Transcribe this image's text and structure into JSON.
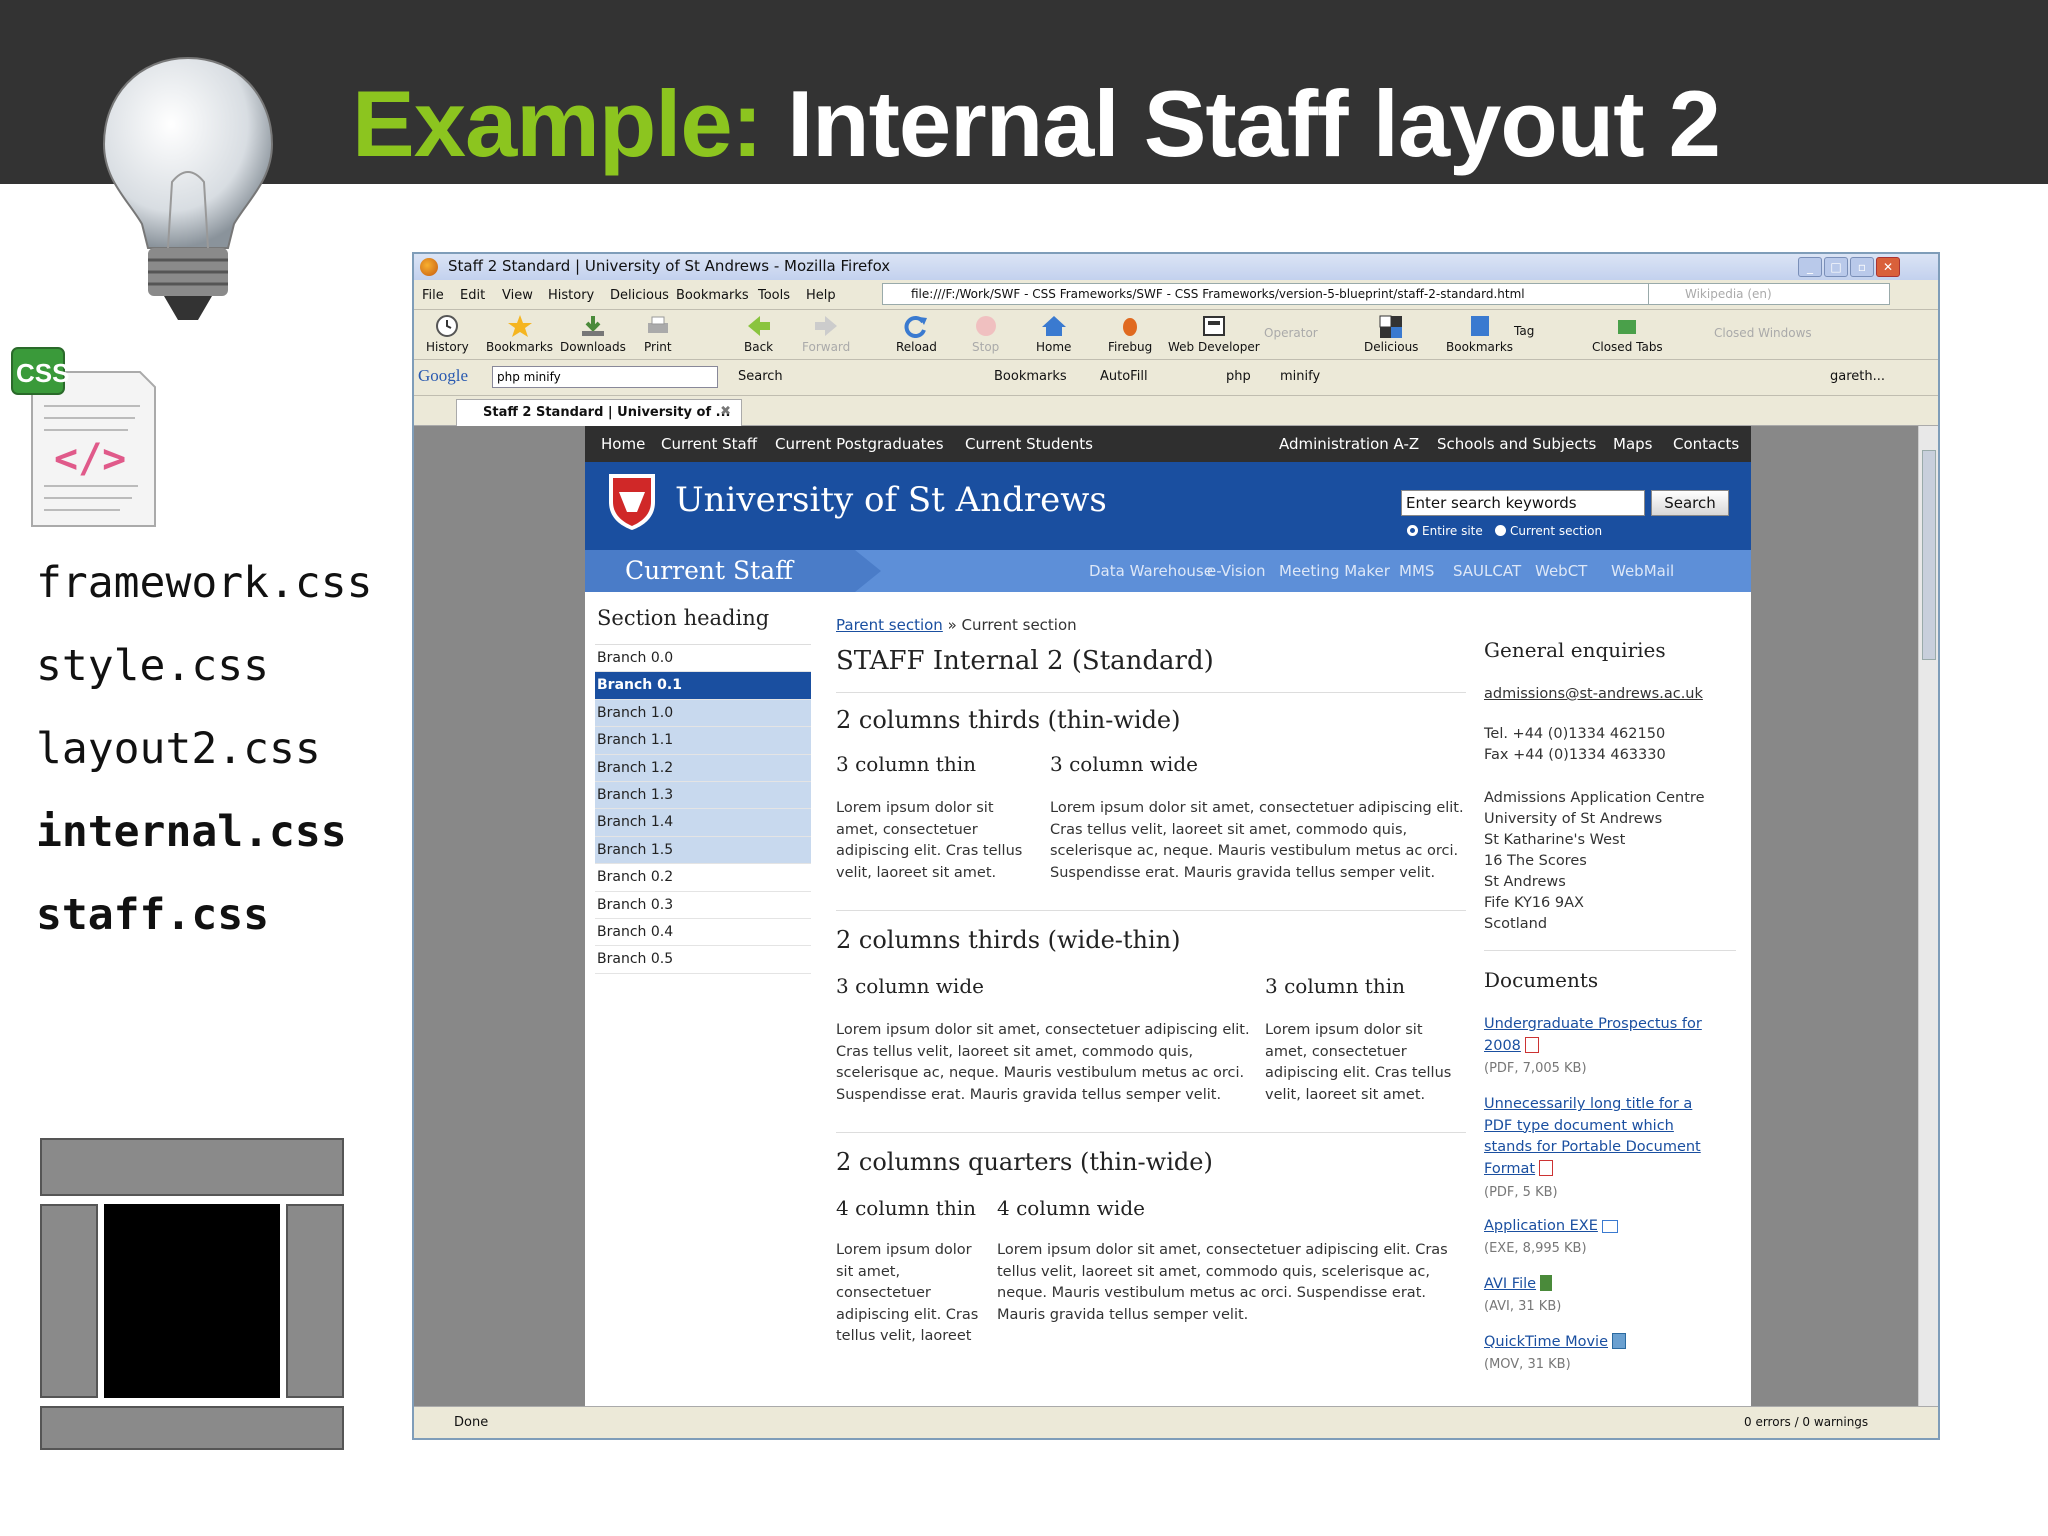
{
  "slide": {
    "title_highlight": "Example:",
    "title_rest": " Internal Staff layout 2",
    "files": [
      "framework.css",
      "style.css",
      "layout2.css",
      "internal.css",
      "staff.css"
    ],
    "css_badge": "CSS",
    "colors": {
      "accent": "#8cc51f",
      "banner": "#1a4fa0"
    }
  },
  "browser": {
    "window_title": "Staff 2 Standard | University of St Andrews - Mozilla Firefox",
    "menu": [
      "File",
      "Edit",
      "View",
      "History",
      "Delicious",
      "Bookmarks",
      "Tools",
      "Help"
    ],
    "url": "file:///F:/Work/SWF - CSS Frameworks/SWF - CSS Frameworks/version-5-blueprint/staff-2-standard.html",
    "wiki_placeholder": "Wikipedia (en)",
    "toolbar": [
      "History",
      "Bookmarks",
      "Downloads",
      "Print",
      "Back",
      "Forward",
      "Reload",
      "Stop",
      "Home",
      "Firebug",
      "Web Developer",
      "Operator",
      "Delicious",
      "Bookmarks",
      "Tag",
      "Closed Tabs",
      "Closed Windows"
    ],
    "google": {
      "logo": "Google",
      "query": "php minify",
      "search": "Search",
      "bookmarks": "Bookmarks",
      "autofill": "AutoFill",
      "php": "php",
      "minify": "minify",
      "user": "gareth..."
    },
    "tab_label": "Staff 2 Standard | University of ...",
    "status": "Done",
    "errors": "0 errors / 0 warnings"
  },
  "page": {
    "topnav_left": [
      "Home",
      "Current Staff",
      "Current Postgraduates",
      "Current Students"
    ],
    "topnav_right": [
      "Administration A-Z",
      "Schools and Subjects",
      "Maps",
      "Contacts"
    ],
    "university": "University of St Andrews",
    "search_placeholder": "Enter search keywords",
    "search_button": "Search",
    "radio_entire": "Entire site",
    "radio_current": "Current section",
    "section_name": "Current Staff",
    "quicklinks": [
      "Data Warehouse",
      "e-Vision",
      "Meeting Maker",
      "MMS",
      "SAULCAT",
      "WebCT",
      "WebMail"
    ],
    "section_heading": "Section heading",
    "branches": [
      "Branch 0.0",
      "Branch 0.1",
      "Branch 1.0",
      "Branch 1.1",
      "Branch 1.2",
      "Branch 1.3",
      "Branch 1.4",
      "Branch 1.5",
      "Branch 0.2",
      "Branch 0.3",
      "Branch 0.4",
      "Branch 0.5"
    ],
    "crumb_parent": "Parent section",
    "crumb_sep": " » ",
    "crumb_current": "Current section",
    "page_title": "STAFF Internal 2 (Standard)",
    "h_thin_wide": "2 columns thirds (thin-wide)",
    "h_wide_thin": "2 columns thirds (wide-thin)",
    "h_quarters": "2 columns quarters (thin-wide)",
    "col3_thin": "3 column thin",
    "col3_wide": "3 column wide",
    "col4_thin": "4 column thin",
    "col4_wide": "4 column wide",
    "lorem_short": "Lorem ipsum dolor sit amet, consectetuer adipiscing elit. Cras tellus velit, laoreet sit amet.",
    "lorem_long": "Lorem ipsum dolor sit amet, consectetuer adipiscing elit. Cras tellus velit, laoreet sit amet, commodo quis, scelerisque ac, neque. Mauris vestibulum metus ac orci. Suspendisse erat. Mauris gravida tellus semper velit.",
    "lorem_q_thin": "Lorem ipsum dolor sit amet, consectetuer adipiscing elit. Cras tellus velit, laoreet",
    "enquiries_heading": "General enquiries",
    "email": "admissions@st-andrews.ac.uk",
    "tel": "Tel. +44 (0)1334 462150",
    "fax": "Fax +44 (0)1334 463330",
    "address": [
      "Admissions Application Centre",
      "University of St Andrews",
      "St Katharine's West",
      "16 The Scores",
      "St Andrews",
      "Fife KY16 9AX",
      "Scotland"
    ],
    "documents_heading": "Documents",
    "docs": [
      {
        "title": "Undergraduate Prospectus for 2008",
        "meta": "(PDF, 7,005 KB)"
      },
      {
        "title": "Unnecessarily long title for a PDF type document which stands for Portable Document Format",
        "meta": "(PDF, 5 KB)"
      },
      {
        "title": "Application EXE",
        "meta": "(EXE, 8,995 KB)"
      },
      {
        "title": "AVI File",
        "meta": "(AVI, 31 KB)"
      },
      {
        "title": "QuickTime Movie",
        "meta": "(MOV, 31 KB)"
      }
    ]
  }
}
